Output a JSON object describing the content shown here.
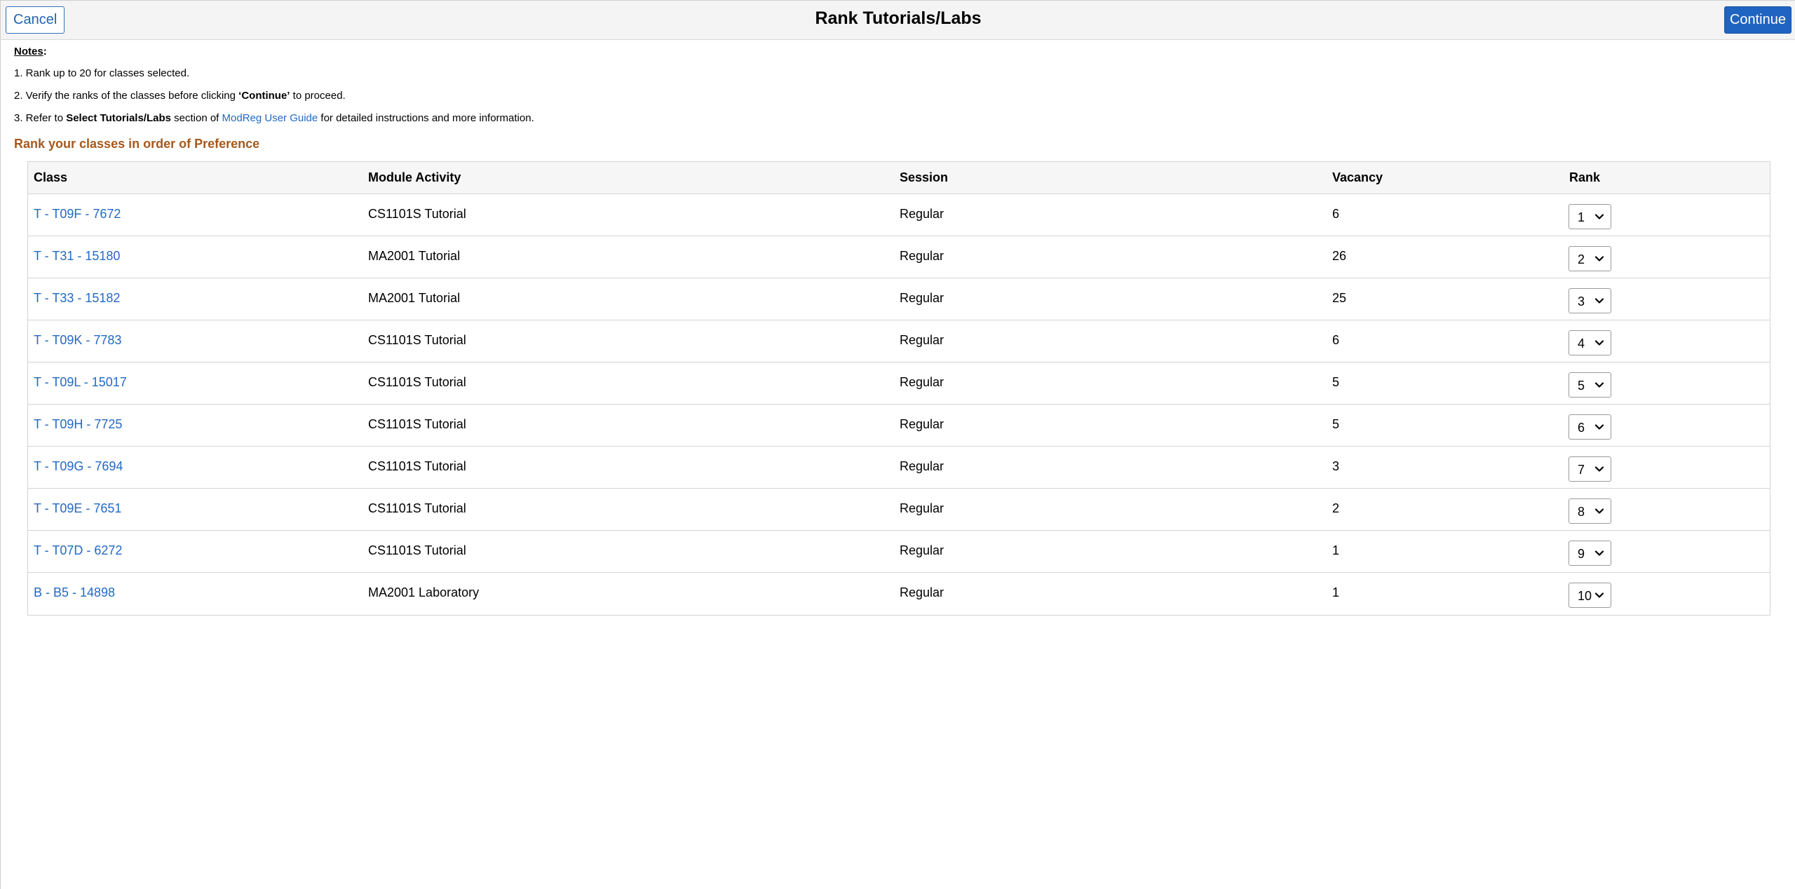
{
  "header": {
    "cancel_label": "Cancel",
    "title": "Rank Tutorials/Labs",
    "continue_label": "Continue"
  },
  "notes": {
    "heading": "Notes",
    "colon": ":",
    "line1": "1. Rank up to 20 for classes selected.",
    "line2_prefix": "2. Verify the ranks of the classes before clicking ",
    "line2_bold": "‘Continue’",
    "line2_suffix": " to proceed.",
    "line3_prefix": "3. Refer to ",
    "line3_bold": "Select Tutorials/Labs",
    "line3_mid": " section of ",
    "line3_link": "ModReg User Guide",
    "line3_suffix": " for detailed instructions and more information."
  },
  "section_heading": "Rank your classes in order of Preference",
  "table": {
    "columns": [
      "Class",
      "Module Activity",
      "Session",
      "Vacancy",
      "Rank"
    ],
    "rows": [
      {
        "class": "T - T09F - 7672",
        "activity": "CS1101S Tutorial",
        "session": "Regular",
        "vacancy": "6",
        "rank": "1"
      },
      {
        "class": "T - T31 - 15180",
        "activity": "MA2001 Tutorial",
        "session": "Regular",
        "vacancy": "26",
        "rank": "2"
      },
      {
        "class": "T - T33 - 15182",
        "activity": "MA2001 Tutorial",
        "session": "Regular",
        "vacancy": "25",
        "rank": "3"
      },
      {
        "class": "T - T09K - 7783",
        "activity": "CS1101S Tutorial",
        "session": "Regular",
        "vacancy": "6",
        "rank": "4"
      },
      {
        "class": "T - T09L - 15017",
        "activity": "CS1101S Tutorial",
        "session": "Regular",
        "vacancy": "5",
        "rank": "5"
      },
      {
        "class": "T - T09H - 7725",
        "activity": "CS1101S Tutorial",
        "session": "Regular",
        "vacancy": "5",
        "rank": "6"
      },
      {
        "class": "T - T09G - 7694",
        "activity": "CS1101S Tutorial",
        "session": "Regular",
        "vacancy": "3",
        "rank": "7"
      },
      {
        "class": "T - T09E - 7651",
        "activity": "CS1101S Tutorial",
        "session": "Regular",
        "vacancy": "2",
        "rank": "8"
      },
      {
        "class": "T - T07D - 6272",
        "activity": "CS1101S Tutorial",
        "session": "Regular",
        "vacancy": "1",
        "rank": "9"
      },
      {
        "class": "B - B5 - 14898",
        "activity": "MA2001 Laboratory",
        "session": "Regular",
        "vacancy": "1",
        "rank": "10"
      }
    ]
  },
  "colors": {
    "link": "#2369c5",
    "primary_button": "#1f64c0",
    "section_heading": "#a6581c"
  },
  "icons": {
    "rank_select": "chevron-down-icon"
  }
}
